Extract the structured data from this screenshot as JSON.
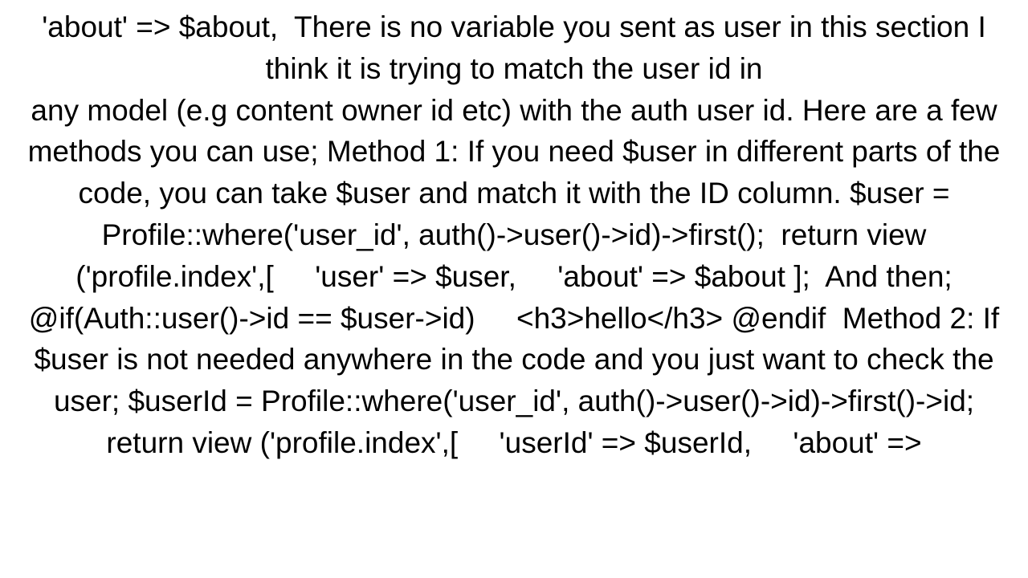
{
  "body_text": "'about' => $about,  There is no variable you sent as user in this section I think it is trying to match the user id in\nany model (e.g content owner id etc) with the auth user id. Here are a few methods you can use; Method 1: If you need $user in different parts of the code, you can take $user and match it with the ID column. $user = Profile::where('user_id', auth()->user()->id)->first();  return view ('profile.index',[     'user' => $user,     'about' => $about ];  And then; @if(Auth::user()->id == $user->id)     <h3>hello</h3> @endif  Method 2: If $user is not needed anywhere in the code and you just want to check the user; $userId = Profile::where('user_id', auth()->user()->id)->first()->id;  return view ('profile.index',[     'userId' => $userId,     'about' =>"
}
